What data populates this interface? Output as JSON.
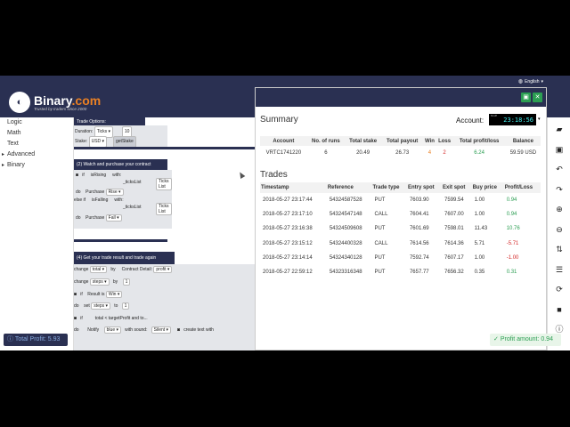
{
  "topbar": {
    "language": "English"
  },
  "header": {
    "brand_name": "Binary",
    "brand_suffix": ".com",
    "tagline": "Trusted by traders since 2000"
  },
  "sidebar": {
    "items": [
      {
        "label": "Logic",
        "arrow": false
      },
      {
        "label": "Math",
        "arrow": false
      },
      {
        "label": "Text",
        "arrow": false
      },
      {
        "label": "Advanced",
        "arrow": true
      },
      {
        "label": "Binary",
        "arrow": true
      }
    ],
    "total_profit": "Total Profit: 5.93"
  },
  "workspace": {
    "trade_options": "Trade Options:",
    "duration_label": "Duration:",
    "duration_unit": "Ticks",
    "duration_value": "10",
    "stake_label": "Stake:",
    "stake_currency": "USD",
    "stake_var": "getStake",
    "section2": "(2) Watch and purchase your contract",
    "if_label": "if",
    "is_rising": "isRising",
    "with_label": "with:",
    "ticks_list_var": "_ticksList",
    "ticks_list_label": "Ticks List",
    "do_label": "do",
    "purchase_label": "Purchase",
    "rise": "Rise",
    "else_if": "else if",
    "is_falling": "isFalling",
    "fall": "Fall",
    "section4": "(4) Get your trade result and trade again",
    "change_label": "change",
    "total_var": "total",
    "by_label": "by",
    "contract_detail": "Contract Detail:",
    "profit": "profit",
    "steps_var": "steps",
    "one": "1",
    "result_is": "Result is",
    "win": "Win",
    "set_label": "set",
    "to_label": "to",
    "cond": "total < targetProfit and to...",
    "notify": "Notify",
    "blue": "blue",
    "with_sound": "with sound:",
    "silent": "Silent",
    "create_text": "create text with"
  },
  "modal": {
    "summary_title": "Summary",
    "account_label": "Account:",
    "clock_top": "BLUE",
    "clock_time": "23:18:56",
    "summary_headers": [
      "Account",
      "No. of runs",
      "Total stake",
      "Total payout",
      "Win",
      "Loss",
      "Total profit/loss",
      "Balance"
    ],
    "summary_row": [
      "VRTC1741220",
      "6",
      "20.49",
      "26.73",
      "4",
      "2",
      "6.24",
      "59.59 USD"
    ],
    "trades_title": "Trades",
    "trades_headers": [
      "Timestamp",
      "Reference",
      "Trade type",
      "Entry spot",
      "Exit spot",
      "Buy price",
      "Profit/Loss"
    ],
    "trades_rows": [
      [
        "2018-05-27 23:17:44",
        "54324587528",
        "PUT",
        "7603.90",
        "7599.54",
        "1.00",
        "0.94"
      ],
      [
        "2018-05-27 23:17:10",
        "54324547148",
        "CALL",
        "7604.41",
        "7607.00",
        "1.00",
        "0.94"
      ],
      [
        "2018-05-27 23:16:38",
        "54324509608",
        "PUT",
        "7601.69",
        "7598.01",
        "11.43",
        "10.76"
      ],
      [
        "2018-05-27 23:15:12",
        "54324400328",
        "CALL",
        "7614.56",
        "7614.36",
        "5.71",
        "-5.71"
      ],
      [
        "2018-05-27 23:14:14",
        "54324340128",
        "PUT",
        "7592.74",
        "7607.17",
        "1.00",
        "-1.00"
      ],
      [
        "2018-05-27 22:59:12",
        "54323316348",
        "PUT",
        "7657.77",
        "7656.32",
        "0.35",
        "0.31"
      ]
    ],
    "profit_signs": [
      "pos",
      "pos",
      "pos",
      "neg",
      "neg",
      "pos"
    ]
  },
  "toolbar": {
    "icons": [
      "folder-icon",
      "save-icon",
      "undo-icon",
      "redo-icon",
      "zoom-in-icon",
      "zoom-out-icon",
      "sort-icon",
      "list-icon",
      "refresh-icon",
      "stop-icon",
      "info-icon"
    ]
  },
  "profit_amount": "Profit amount: 0.94"
}
